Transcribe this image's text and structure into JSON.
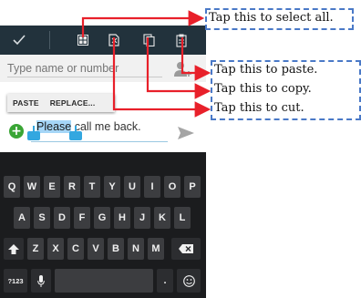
{
  "compose": {
    "recipient_placeholder": "Type name or number",
    "message_highlighted": "Please",
    "message_rest": " call me back."
  },
  "popup": {
    "paste_label": "PASTE",
    "replace_label": "REPLACE..."
  },
  "action_bar": {
    "icons": [
      "check-icon",
      "select-all-icon",
      "cut-icon",
      "copy-icon",
      "paste-icon"
    ]
  },
  "keyboard": {
    "row1": [
      "Q",
      "W",
      "E",
      "R",
      "T",
      "Y",
      "U",
      "I",
      "O",
      "P"
    ],
    "row2": [
      "A",
      "S",
      "D",
      "F",
      "G",
      "H",
      "J",
      "K",
      "L"
    ],
    "row3": [
      "Z",
      "X",
      "C",
      "V",
      "B",
      "N",
      "M"
    ],
    "symbols_key": "?123",
    "period_key": "."
  },
  "callouts": {
    "select_all": "Tap this to select all.",
    "paste": "Tap this to paste.",
    "copy": "Tap this to copy.",
    "cut": "Tap this to cut."
  },
  "colors": {
    "action_bar": "#22323c",
    "callout_line": "#e8202a",
    "callout_border": "#4a79c7",
    "selection": "#a5d6f7",
    "attach_green": "#3aa535",
    "keyboard_bg": "#1b1c1e"
  }
}
